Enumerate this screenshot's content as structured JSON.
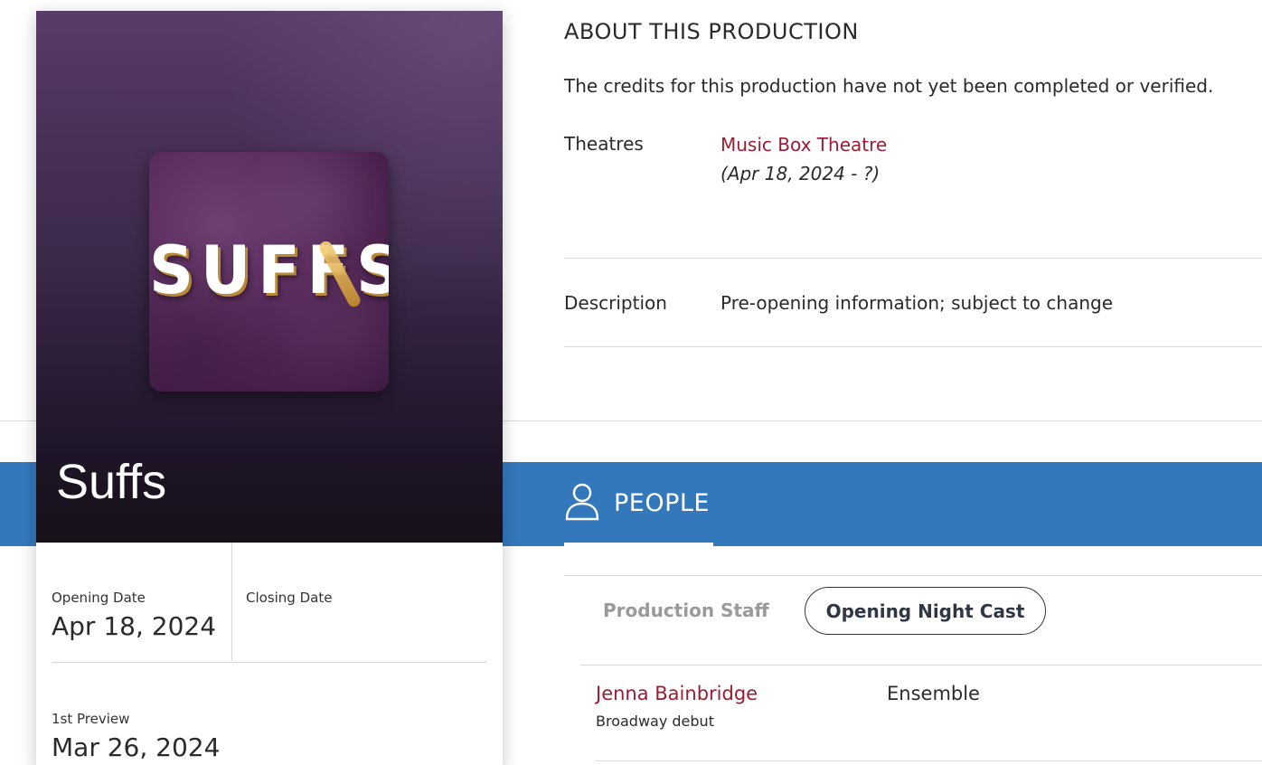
{
  "show": {
    "title": "Suffs",
    "poster_word": "SUFFS",
    "opening_date_label": "Opening Date",
    "opening_date_value": "Apr 18, 2024",
    "closing_date_label": "Closing Date",
    "closing_date_value": "",
    "first_preview_label": "1st Preview",
    "first_preview_value": "Mar 26, 2024"
  },
  "about": {
    "heading": "ABOUT THIS PRODUCTION",
    "note": "The credits for this production have not yet been completed or verified.",
    "theatres_label": "Theatres",
    "theatre_name": "Music Box Theatre",
    "theatre_dates": "(Apr 18, 2024 - ?)",
    "description_label": "Description",
    "description_value": "Pre-opening information; subject to change"
  },
  "people": {
    "icon": "person-icon",
    "heading": "PEOPLE",
    "tabs": [
      {
        "label": "Production Staff",
        "active": false
      },
      {
        "label": "Opening Night Cast",
        "active": true
      }
    ],
    "cast": [
      {
        "name": "Jenna Bainbridge",
        "note": "Broadway debut",
        "role": "Ensemble"
      }
    ]
  },
  "colors": {
    "people_band": "#3478bc",
    "link": "#9b1c33",
    "hero_top": "#583d68",
    "hero_bottom": "#171019"
  }
}
